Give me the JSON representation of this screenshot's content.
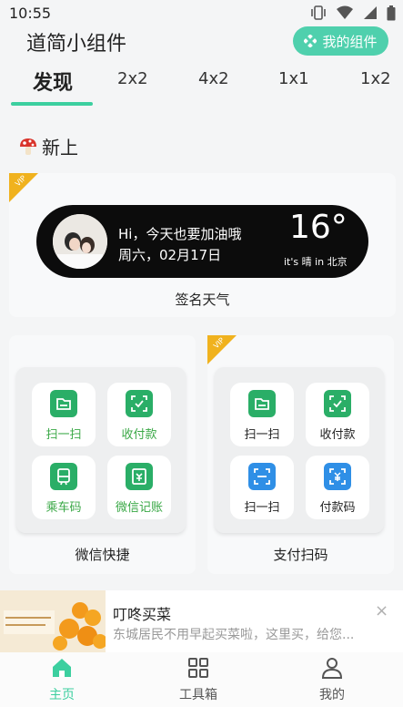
{
  "status_bar": {
    "time": "10:55"
  },
  "header": {
    "title": "道简小组件",
    "my_widgets_label": "我的组件"
  },
  "tabs": [
    {
      "label": "发现",
      "active": true
    },
    {
      "label": "2x2"
    },
    {
      "label": "4x2"
    },
    {
      "label": "1x1"
    },
    {
      "label": "1x2"
    }
  ],
  "section": {
    "title": "新上",
    "icon": "mushroom-icon"
  },
  "weather_widget": {
    "vip_badge": "VIP",
    "greeting": "Hi，今天也要加油哦",
    "date": "周六，02月17日",
    "temperature": "16°",
    "weather_location": "it's 晴 in 北京",
    "name": "签名天气"
  },
  "wechat_widget": {
    "name": "微信快捷",
    "tiles": [
      {
        "label": "扫一扫",
        "icon": "folder-scan-icon"
      },
      {
        "label": "收付款",
        "icon": "payment-check-icon"
      },
      {
        "label": "乘车码",
        "icon": "bus-code-icon"
      },
      {
        "label": "微信记账",
        "icon": "bookkeeping-icon"
      }
    ]
  },
  "pay_widget": {
    "vip_badge": "VIP",
    "name": "支付扫码",
    "tiles": [
      {
        "label": "扫一扫",
        "icon": "folder-scan-icon"
      },
      {
        "label": "收付款",
        "icon": "payment-check-icon"
      },
      {
        "label": "扫一扫",
        "icon": "scan-icon"
      },
      {
        "label": "付款码",
        "icon": "pay-code-icon"
      }
    ]
  },
  "ad": {
    "title": "叮咚买菜",
    "description": "东城居民不用早起买菜啦，这里买，给您...",
    "close": "×"
  },
  "bottom_nav": [
    {
      "label": "主页",
      "icon": "home-icon",
      "active": true
    },
    {
      "label": "工具箱",
      "icon": "grid-icon"
    },
    {
      "label": "我的",
      "icon": "profile-icon"
    }
  ],
  "colors": {
    "accent": "#3ccf9f",
    "my_widgets_button": "#4fd0ad",
    "wechat_green": "#2aae67",
    "wechat_text": "#3aa846",
    "alipay_blue": "#2f8fe6",
    "vip_gold": "#f0b21e"
  }
}
